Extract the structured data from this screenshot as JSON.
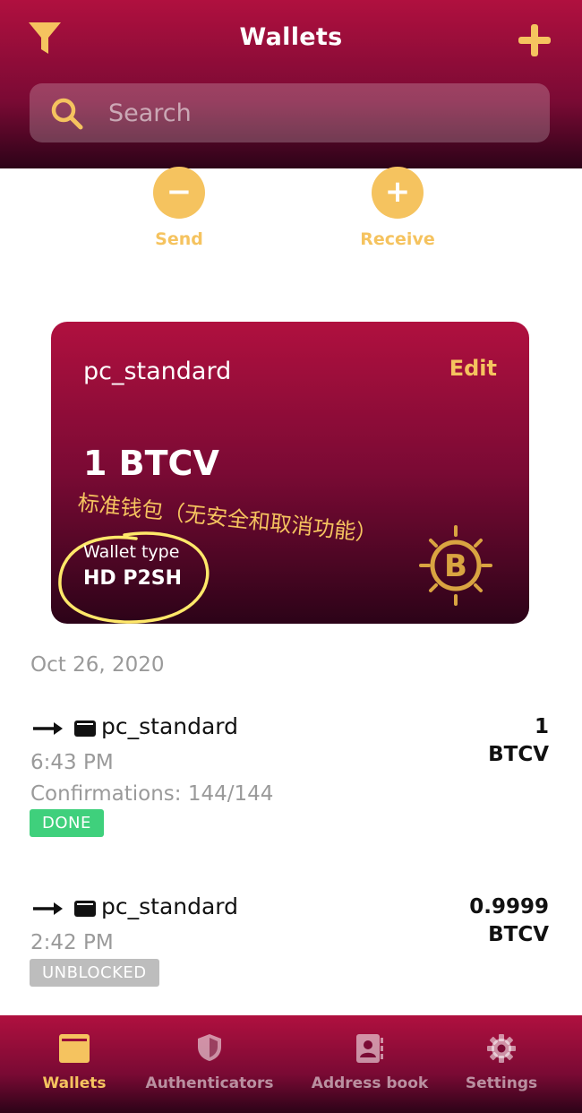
{
  "header": {
    "title": "Wallets",
    "filter_icon": "filter-icon",
    "add_icon": "plus-icon",
    "search_placeholder": "Search"
  },
  "actions": {
    "send_label": "Send",
    "send_symbol": "−",
    "receive_label": "Receive",
    "receive_symbol": "+"
  },
  "wallet_card": {
    "name": "pc_standard",
    "edit_label": "Edit",
    "balance": "1 BTCV",
    "annotation": "标准钱包（无安全和取消功能）",
    "type_label": "Wallet type",
    "type_value": "HD P2SH",
    "logo_icon": "bitcoin-vault-icon"
  },
  "transactions": {
    "date": "Oct 26, 2020",
    "items": [
      {
        "wallet": "pc_standard",
        "amount_value": "1",
        "amount_unit": "BTCV",
        "time": "6:43 PM",
        "confirmations": "Confirmations: 144/144",
        "status": "DONE"
      },
      {
        "wallet": "pc_standard",
        "amount_value": "0.9999",
        "amount_unit": "BTCV",
        "time": "2:42 PM",
        "status": "UNBLOCKED"
      }
    ]
  },
  "bottom_nav": {
    "items": [
      {
        "label": "Wallets",
        "icon": "wallet-icon",
        "active": true
      },
      {
        "label": "Authenticators",
        "icon": "shield-icon",
        "active": false
      },
      {
        "label": "Address book",
        "icon": "address-book-icon",
        "active": false
      },
      {
        "label": "Settings",
        "icon": "gear-icon",
        "active": false
      }
    ]
  },
  "colors": {
    "brand": "#b0103f",
    "brand_dark": "#2c0318",
    "accent": "#f5c35f",
    "done": "#3fd07c",
    "unblocked": "#bdbdbd",
    "muted_text": "#9a9a9a"
  }
}
